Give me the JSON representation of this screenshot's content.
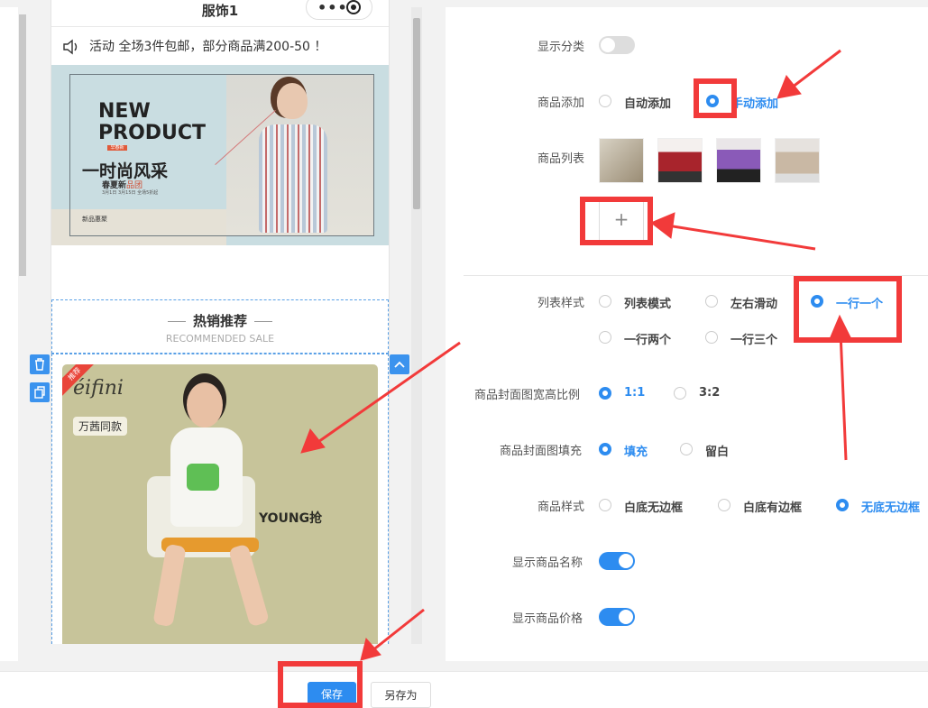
{
  "preview": {
    "page_title": "服饰1",
    "notice_text": "活动 全场3件包邮，部分商品满200-50 ！",
    "banner": {
      "headline_line1": "NEW",
      "headline_line2": "PRODUCT",
      "tag": "早春新",
      "cn_title": "一时尚风采",
      "sub_prefix": "春夏新",
      "sub_highlight": "品团",
      "tiny": "3月1日 3月15日 全场5折起",
      "footer_label": "新品惠聚"
    },
    "section_title": "热销推荐",
    "section_subtitle": "RECOMMENDED SALE",
    "product": {
      "ribbon": "推荐",
      "brand": "éifini",
      "pill": "万茜同款",
      "overlay_text": "YOUNG抢"
    }
  },
  "settings": {
    "show_category_label": "显示分类",
    "show_category_on": false,
    "goods_add": {
      "label": "商品添加",
      "options": [
        "自动添加",
        "手动添加"
      ],
      "selected": "手动添加"
    },
    "goods_list": {
      "label": "商品列表",
      "add_symbol": "+"
    },
    "list_style": {
      "label": "列表样式",
      "options": [
        "列表模式",
        "左右滑动",
        "一行一个",
        "一行两个",
        "一行三个"
      ],
      "selected": "一行一个"
    },
    "cover_ratio": {
      "label": "商品封面图宽高比例",
      "options": [
        "1:1",
        "3:2"
      ],
      "selected": "1:1"
    },
    "cover_fill": {
      "label": "商品封面图填充",
      "options": [
        "填充",
        "留白"
      ],
      "selected": "填充"
    },
    "goods_style": {
      "label": "商品样式",
      "options": [
        "白底无边框",
        "白底有边框",
        "无底无边框"
      ],
      "selected": "无底无边框"
    },
    "show_name": {
      "label": "显示商品名称",
      "on": true
    },
    "show_price": {
      "label": "显示商品价格",
      "on": true
    }
  },
  "footer": {
    "save_label": "保存",
    "save_as_label": "另存为"
  },
  "colors": {
    "accent": "#2d8cf0",
    "annotation": "#f23a3a"
  }
}
